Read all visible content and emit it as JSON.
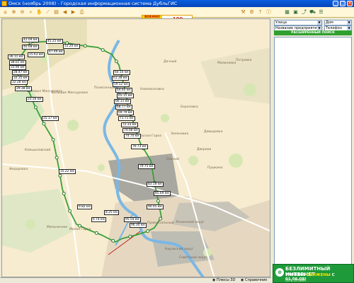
{
  "window": {
    "title": "Омск (ноябрь 2008) - Городская информационная система ДубльГИС"
  },
  "toolbar": {
    "logo_left": "ВОЕННО ДЛЯ ПРАЗДНИКА",
    "logo_right": "100 подарков"
  },
  "panel": {
    "street_label": "Улица",
    "street_mode": "Дом",
    "org_label": "Название предприятия",
    "org_mode": "Телефон",
    "extended_search": "РАСШИРЕННЫЙ ПОИСК"
  },
  "status": {
    "plus3d": "Плюсы 3D",
    "info": "Справочник"
  },
  "ad": {
    "line1": "БЕЗЛИМИТНЫЙ ИНТЕРНЕТ",
    "line2a": "ТАРИФЫ ",
    "line2b": "СНИЖЕНЫ",
    "line2c": " С 01.06.08!",
    "line3": "СЕТЬ ОПТИКА"
  },
  "places": [
    "Дачный",
    "Малиновка",
    "Петровка",
    "Полигонный",
    "Березовка",
    "Новомосковка",
    "Зеленовка",
    "Давыдовка",
    "Красная Горка",
    "Дворики",
    "Омский",
    "Пушкино",
    "Федоровка",
    "Камышловский",
    "Мельничное",
    "Кировский округ",
    "Ленинский округ",
    "Советский округ",
    "Привокзальный",
    "Малая Горка",
    "Новые Мансуровка",
    "Большие Мансуровка"
  ],
  "route_labels": [
    "42.09 км",
    "45.25 км",
    "40.68 км",
    "31.20 км",
    "47.49 км",
    "15.63 км",
    "36.11 км",
    "38.01 км",
    "33.90 км",
    "28.47 км",
    "32.35 км",
    "60.10 км",
    "32.28 км",
    "61.38 км",
    "29.38 км",
    "59.52 км",
    "64.60 км",
    "65.15 км",
    "66.11 км",
    "23.56 км",
    "68.77 км",
    "69.79 км",
    "71.71 км",
    "72.33 км",
    "74.08 км",
    "25.17 км",
    "74.70 км",
    "76.73 км",
    "79.75 км",
    "83.58 км",
    "35.22 км",
    "85.69 км",
    "9.82 км",
    "8.25 км",
    "90.05 км",
    "6.74 км",
    "95.54 км",
    "96.30 км"
  ]
}
